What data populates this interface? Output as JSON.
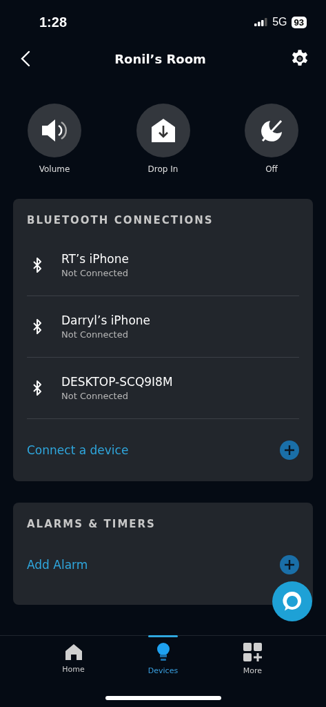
{
  "status_bar": {
    "time": "1:28",
    "network": "5G",
    "battery": "93"
  },
  "header": {
    "title": "Ronil’s Room"
  },
  "actions": [
    {
      "kind": "volume",
      "label": "Volume"
    },
    {
      "kind": "drop_in",
      "label": "Drop In"
    },
    {
      "kind": "off",
      "label": "Off"
    }
  ],
  "bluetooth": {
    "title": "BLUETOOTH CONNECTIONS",
    "devices": [
      {
        "name": "RT’s iPhone",
        "status": "Not Connected"
      },
      {
        "name": "Darryl’s iPhone",
        "status": "Not Connected"
      },
      {
        "name": "DESKTOP-SCQ9I8M",
        "status": "Not Connected"
      }
    ],
    "add_label": "Connect a device"
  },
  "alarms": {
    "title": "ALARMS & TIMERS",
    "add_label": "Add Alarm"
  },
  "nav": [
    {
      "kind": "home",
      "label": "Home",
      "selected": false
    },
    {
      "kind": "devices",
      "label": "Devices",
      "selected": true
    },
    {
      "kind": "more",
      "label": "More",
      "selected": false
    }
  ]
}
